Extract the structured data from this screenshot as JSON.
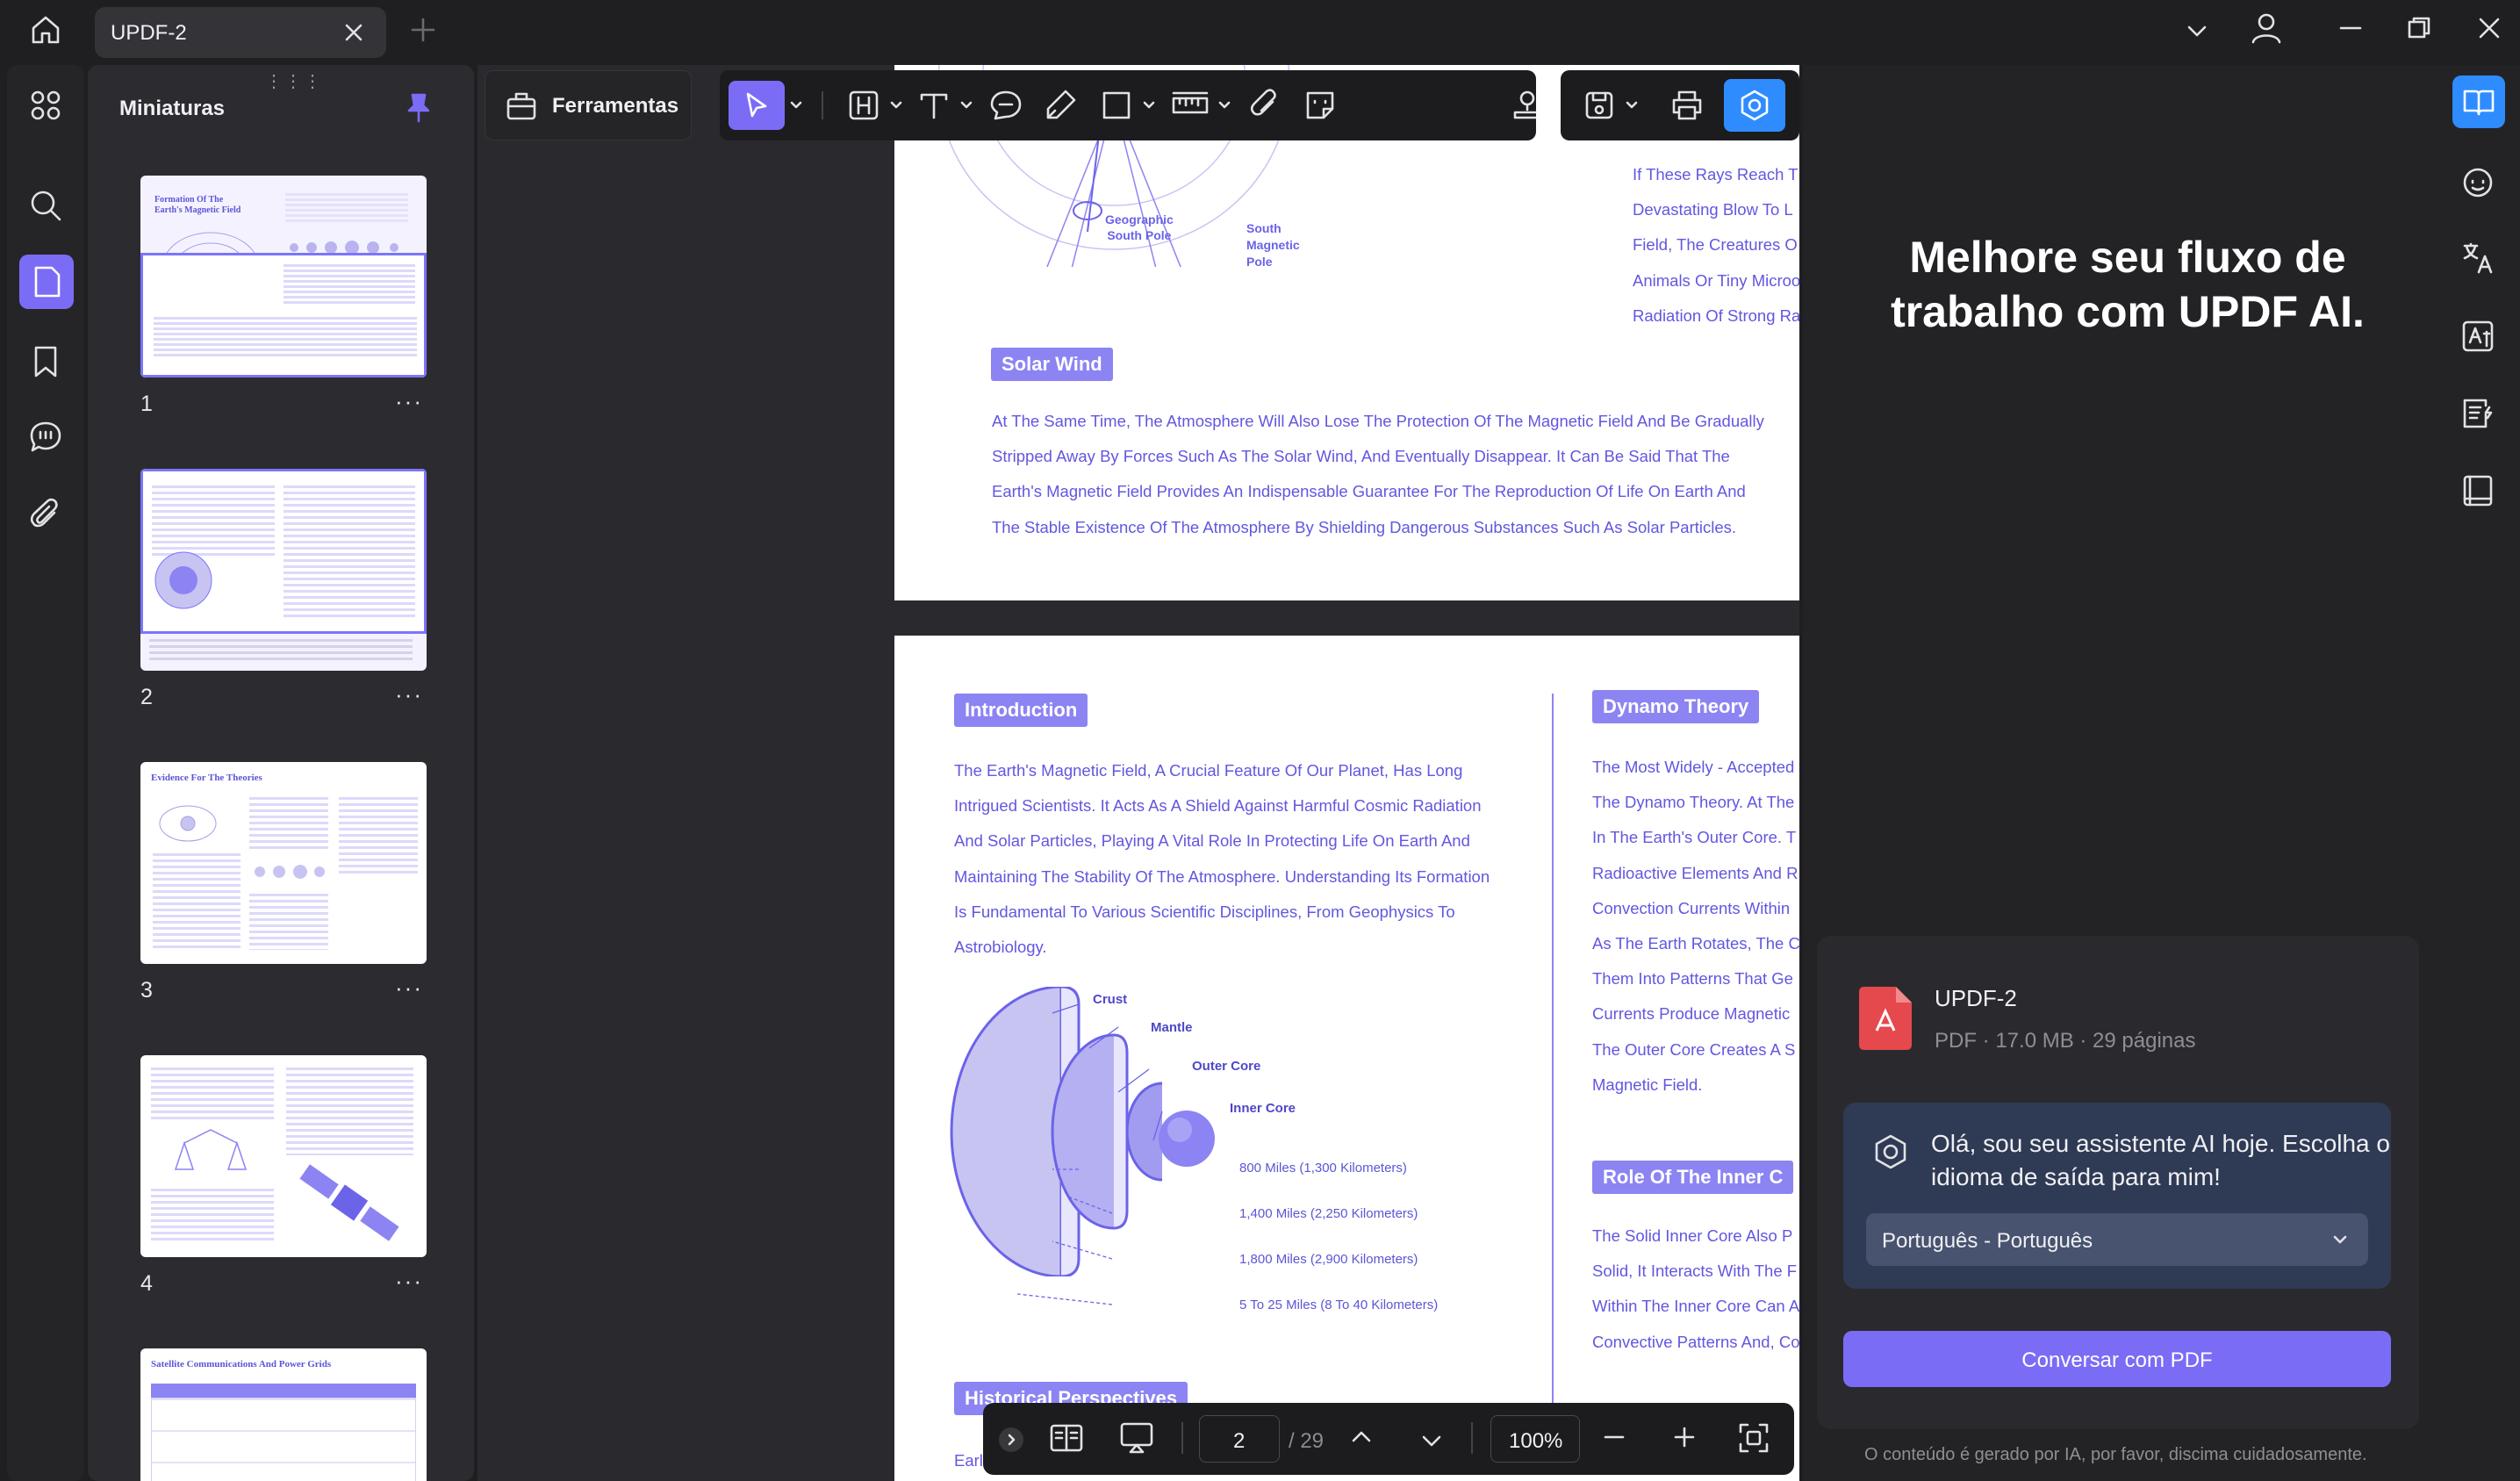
{
  "app": {
    "tab_title": "UPDF-2"
  },
  "thumbnails": {
    "title": "Miniaturas",
    "pages": [
      {
        "number": "1",
        "heading": "Formation Of The Earth's Magnetic Field"
      },
      {
        "number": "2",
        "heading": ""
      },
      {
        "number": "3",
        "heading": "Evidence For The Theories"
      },
      {
        "number": "4",
        "heading": ""
      },
      {
        "number": "",
        "heading": "Satellite Communications And Power Grids"
      }
    ],
    "more": "···"
  },
  "toolbar": {
    "tools_label": "Ferramentas"
  },
  "page1": {
    "label_south_geo": "Geographic\nSouth Pole",
    "label_south_mag": "South\nMagnetic\nPole",
    "right_lines": [
      "If These Rays Reach T",
      "Devastating Blow To L",
      "Field, The Creatures O",
      "Animals Or Tiny Microo",
      "Radiation Of Strong Ra"
    ],
    "solar_heading": "Solar Wind",
    "solar_lines": [
      "At The Same Time, The Atmosphere Will Also Lose The Protection Of The Magnetic Field And Be Gradually",
      "Stripped Away By Forces Such As The Solar Wind, And Eventually Disappear. It Can Be Said That The",
      "Earth's Magnetic Field Provides An Indispensable Guarantee For The Reproduction Of Life On Earth And",
      "The Stable Existence Of The Atmosphere By Shielding Dangerous Substances Such As Solar Particles."
    ]
  },
  "page2": {
    "intro_heading": "Introduction",
    "intro_lines": [
      "The Earth's Magnetic Field, A Crucial Feature Of Our Planet, Has Long",
      "Intrigued Scientists. It Acts As A Shield Against Harmful Cosmic Radiation",
      "And Solar Particles, Playing A Vital Role In Protecting Life On Earth And",
      "Maintaining The Stability Of The Atmosphere. Understanding Its Formation",
      "Is Fundamental To Various Scientific Disciplines, From Geophysics To",
      "Astrobiology."
    ],
    "layers": [
      "Crust",
      "Mantle",
      "Outer Core",
      "Inner Core"
    ],
    "depths": [
      "800 Miles (1,300 Kilometers)",
      "1,400 Miles (2,250 Kilometers)",
      "1,800 Miles (2,900 Kilometers)",
      "5 To 25 Miles (8 To 40 Kilometers)"
    ],
    "dynamo_heading": "Dynamo Theory",
    "dynamo_lines": [
      "The Most Widely - Accepted",
      "The Dynamo Theory. At The",
      "In The Earth's Outer Core. T",
      "Radioactive Elements And R",
      "Convection Currents Within",
      "As The Earth Rotates, The C",
      "Them Into Patterns That Ge",
      "Currents Produce Magnetic",
      "The Outer Core Creates A S",
      "Magnetic Field."
    ],
    "inner_heading": "Role Of The Inner C",
    "inner_lines": [
      "The Solid Inner Core Also P",
      "Solid, It Interacts With The F",
      "Within The Inner Core Can A",
      "Convective Patterns And, Co"
    ],
    "historical_heading": "Historical Perspectives",
    "last_line": "Earl"
  },
  "bottombar": {
    "page_current": "2",
    "page_total": "/ 29",
    "zoom": "100%"
  },
  "ai_panel": {
    "headline_1": "Melhore seu fluxo de",
    "headline_2": "trabalho com UPDF AI.",
    "file_name": "UPDF-2",
    "file_meta": "PDF · 17.0 MB · 29 páginas",
    "assistant_line_1": "Olá, sou seu assistente AI hoje. Escolha o",
    "assistant_line_2": "idioma de saída para mim!",
    "language": "Português - Português",
    "chat_button": "Conversar com PDF",
    "disclaimer": "O conteúdo é gerado por IA, por favor, discima cuidadosamente."
  },
  "colors": {
    "accent": "#7b6cf6",
    "doc_text": "#6257e0",
    "heading_bg": "#8c84f2"
  }
}
